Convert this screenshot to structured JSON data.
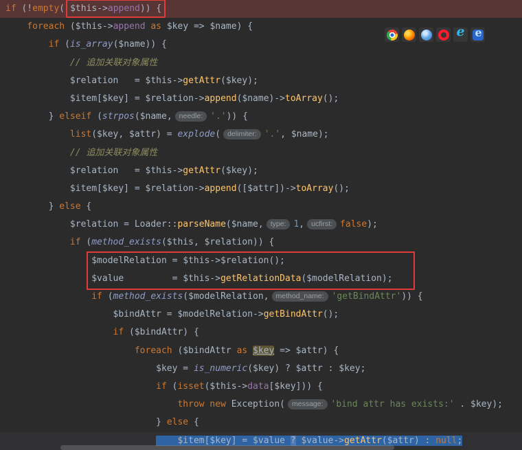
{
  "colors": {
    "background": "#2b2b2b",
    "annotation_red": "#e23b3b",
    "error_line_background": "#573535",
    "selection_blue": "#2e63a4",
    "keyword_orange": "#cc7832",
    "string_green": "#6a8759",
    "method_yellow": "#ffc66d",
    "field_purple": "#9876aa"
  },
  "browser_icons": [
    {
      "name": "chrome-icon",
      "kind": "chrome"
    },
    {
      "name": "firefox-icon",
      "kind": "firefox"
    },
    {
      "name": "chromium-icon",
      "kind": "chromium"
    },
    {
      "name": "opera-icon",
      "kind": "opera"
    },
    {
      "name": "internet-explorer-icon",
      "kind": "ie"
    },
    {
      "name": "edge-icon",
      "kind": "edge"
    }
  ],
  "editor": {
    "language": "PHP",
    "lines": [
      {
        "cls": "line-error",
        "tokens": [
          {
            "c": "kw",
            "t": "if"
          },
          {
            "c": "txt",
            "t": " (!"
          },
          {
            "c": "kw",
            "t": "empty"
          },
          {
            "c": "txt",
            "t": "("
          },
          {
            "g": "redbox",
            "tokens": [
              {
                "c": "txt",
                "t": "$this->"
              },
              {
                "c": "fld",
                "t": "append"
              },
              {
                "c": "txt",
                "t": ")) {"
              }
            ]
          }
        ]
      },
      {
        "tokens": [
          {
            "c": "txt",
            "t": "    "
          },
          {
            "c": "kw",
            "t": "foreach"
          },
          {
            "c": "txt",
            "t": " ($this->"
          },
          {
            "c": "fld",
            "t": "append"
          },
          {
            "c": "txt",
            "t": " "
          },
          {
            "c": "kw",
            "t": "as"
          },
          {
            "c": "txt",
            "t": " $key => $name) {"
          }
        ]
      },
      {
        "tokens": [
          {
            "c": "txt",
            "t": "        "
          },
          {
            "c": "kw",
            "t": "if"
          },
          {
            "c": "txt",
            "t": " ("
          },
          {
            "c": "pre",
            "t": "is_array"
          },
          {
            "c": "txt",
            "t": "($name)) {"
          }
        ]
      },
      {
        "tokens": [
          {
            "c": "txt",
            "t": "            "
          },
          {
            "c": "cmt",
            "t": "// 追加关联对象属性"
          }
        ]
      },
      {
        "tokens": [
          {
            "c": "txt",
            "t": "            $relation   = $this->"
          },
          {
            "c": "fn",
            "t": "getAttr"
          },
          {
            "c": "txt",
            "t": "($key);"
          }
        ]
      },
      {
        "tokens": [
          {
            "c": "txt",
            "t": "            $item[$key] = $relation->"
          },
          {
            "c": "fn",
            "t": "append"
          },
          {
            "c": "txt",
            "t": "($name)->"
          },
          {
            "c": "fn",
            "t": "toArray"
          },
          {
            "c": "txt",
            "t": "();"
          }
        ]
      },
      {
        "tokens": [
          {
            "c": "txt",
            "t": "        } "
          },
          {
            "c": "kw",
            "t": "elseif"
          },
          {
            "c": "txt",
            "t": " ("
          },
          {
            "c": "pre",
            "t": "strpos"
          },
          {
            "c": "txt",
            "t": "($name,"
          },
          {
            "c": "hint",
            "t": "needle:"
          },
          {
            "c": "str",
            "t": "'.'"
          },
          {
            "c": "txt",
            "t": ")) {"
          }
        ]
      },
      {
        "tokens": [
          {
            "c": "txt",
            "t": "            "
          },
          {
            "c": "kw",
            "t": "list"
          },
          {
            "c": "txt",
            "t": "($key, $attr) = "
          },
          {
            "c": "pre",
            "t": "explode"
          },
          {
            "c": "txt",
            "t": "("
          },
          {
            "c": "hint",
            "t": "delimiter:"
          },
          {
            "c": "str",
            "t": "'.'"
          },
          {
            "c": "txt",
            "t": ", $name);"
          }
        ]
      },
      {
        "tokens": [
          {
            "c": "txt",
            "t": "            "
          },
          {
            "c": "cmt",
            "t": "// 追加关联对象属性"
          }
        ]
      },
      {
        "tokens": [
          {
            "c": "txt",
            "t": "            $relation   = $this->"
          },
          {
            "c": "fn",
            "t": "getAttr"
          },
          {
            "c": "txt",
            "t": "($key);"
          }
        ]
      },
      {
        "tokens": [
          {
            "c": "txt",
            "t": "            $item[$key] = $relation->"
          },
          {
            "c": "fn",
            "t": "append"
          },
          {
            "c": "txt",
            "t": "([$attr])->"
          },
          {
            "c": "fn",
            "t": "toArray"
          },
          {
            "c": "txt",
            "t": "();"
          }
        ]
      },
      {
        "tokens": [
          {
            "c": "txt",
            "t": "        } "
          },
          {
            "c": "kw",
            "t": "else"
          },
          {
            "c": "txt",
            "t": " {"
          }
        ]
      },
      {
        "tokens": [
          {
            "c": "txt",
            "t": "            $relation = Loader::"
          },
          {
            "c": "fn",
            "t": "parseName"
          },
          {
            "c": "txt",
            "t": "($name,"
          },
          {
            "c": "hint",
            "t": "type:"
          },
          {
            "c": "num",
            "t": "1"
          },
          {
            "c": "txt",
            "t": ","
          },
          {
            "c": "hint",
            "t": "ucfirst:"
          },
          {
            "c": "kw",
            "t": "false"
          },
          {
            "c": "txt",
            "t": ");"
          }
        ]
      },
      {
        "tokens": [
          {
            "c": "txt",
            "t": "            "
          },
          {
            "c": "kw",
            "t": "if"
          },
          {
            "c": "txt",
            "t": " ("
          },
          {
            "c": "pre",
            "t": "method_exists"
          },
          {
            "c": "txt",
            "t": "($this, $relation)) {"
          }
        ]
      },
      {
        "tokens": [
          {
            "c": "txt",
            "t": "                $modelRelation = $this->$relation();"
          }
        ]
      },
      {
        "tokens": [
          {
            "c": "txt",
            "t": "                $value         = $this->"
          },
          {
            "c": "fn",
            "t": "getRelationData"
          },
          {
            "c": "txt",
            "t": "($modelRelation);"
          }
        ]
      },
      {
        "tokens": [
          {
            "c": "txt",
            "t": "                "
          },
          {
            "c": "kw",
            "t": "if"
          },
          {
            "c": "txt",
            "t": " ("
          },
          {
            "c": "pre",
            "t": "method_exists"
          },
          {
            "c": "txt",
            "t": "($modelRelation,"
          },
          {
            "c": "hint",
            "t": "method_name:"
          },
          {
            "c": "str",
            "t": "'getBindAttr'"
          },
          {
            "c": "txt",
            "t": ")) {"
          }
        ]
      },
      {
        "tokens": [
          {
            "c": "txt",
            "t": "                    $bindAttr = $modelRelation->"
          },
          {
            "c": "fn",
            "t": "getBindAttr"
          },
          {
            "c": "txt",
            "t": "();"
          }
        ]
      },
      {
        "tokens": [
          {
            "c": "txt",
            "t": "                    "
          },
          {
            "c": "kw",
            "t": "if"
          },
          {
            "c": "txt",
            "t": " ($bindAttr) {"
          }
        ]
      },
      {
        "tokens": [
          {
            "c": "txt",
            "t": "                        "
          },
          {
            "c": "kw",
            "t": "foreach"
          },
          {
            "c": "txt",
            "t": " ($bindAttr "
          },
          {
            "c": "kw",
            "t": "as"
          },
          {
            "c": "txt",
            "t": " "
          },
          {
            "c": "txt mark",
            "t": "$key"
          },
          {
            "c": "txt",
            "t": " => $attr) {"
          }
        ]
      },
      {
        "tokens": [
          {
            "c": "txt",
            "t": "                            $key = "
          },
          {
            "c": "pre",
            "t": "is_numeric"
          },
          {
            "c": "txt",
            "t": "($key) ? $attr : $key;"
          }
        ]
      },
      {
        "tokens": [
          {
            "c": "txt",
            "t": "                            "
          },
          {
            "c": "kw",
            "t": "if"
          },
          {
            "c": "txt",
            "t": " ("
          },
          {
            "c": "kw",
            "t": "isset"
          },
          {
            "c": "txt",
            "t": "($this->"
          },
          {
            "c": "fld",
            "t": "data"
          },
          {
            "c": "txt",
            "t": "[$key])) {"
          }
        ]
      },
      {
        "tokens": [
          {
            "c": "txt",
            "t": "                                "
          },
          {
            "c": "kw",
            "t": "throw"
          },
          {
            "c": "txt",
            "t": " "
          },
          {
            "c": "kw",
            "t": "new"
          },
          {
            "c": "txt",
            "t": " Exception("
          },
          {
            "c": "hint",
            "t": "message:"
          },
          {
            "c": "str",
            "t": "'bind attr has exists:'"
          },
          {
            "c": "txt",
            "t": " . $key);"
          }
        ]
      },
      {
        "tokens": [
          {
            "c": "txt",
            "t": "                            } "
          },
          {
            "c": "kw",
            "t": "else"
          },
          {
            "c": "txt",
            "t": " {"
          }
        ]
      },
      {
        "cls": "line-current",
        "tokens": [
          {
            "c": "txt",
            "t": "                            "
          },
          {
            "c": "txt sel",
            "t": "    $item[$key] = $value "
          },
          {
            "c": "txt sel hl",
            "t": "?"
          },
          {
            "c": "txt sel",
            "t": " $value->"
          },
          {
            "c": "fn sel",
            "t": "getAttr"
          },
          {
            "c": "txt sel",
            "t": "($attr) : "
          },
          {
            "c": "kw sel",
            "t": "null"
          },
          {
            "c": "txt sel",
            "t": ";"
          }
        ]
      }
    ]
  }
}
